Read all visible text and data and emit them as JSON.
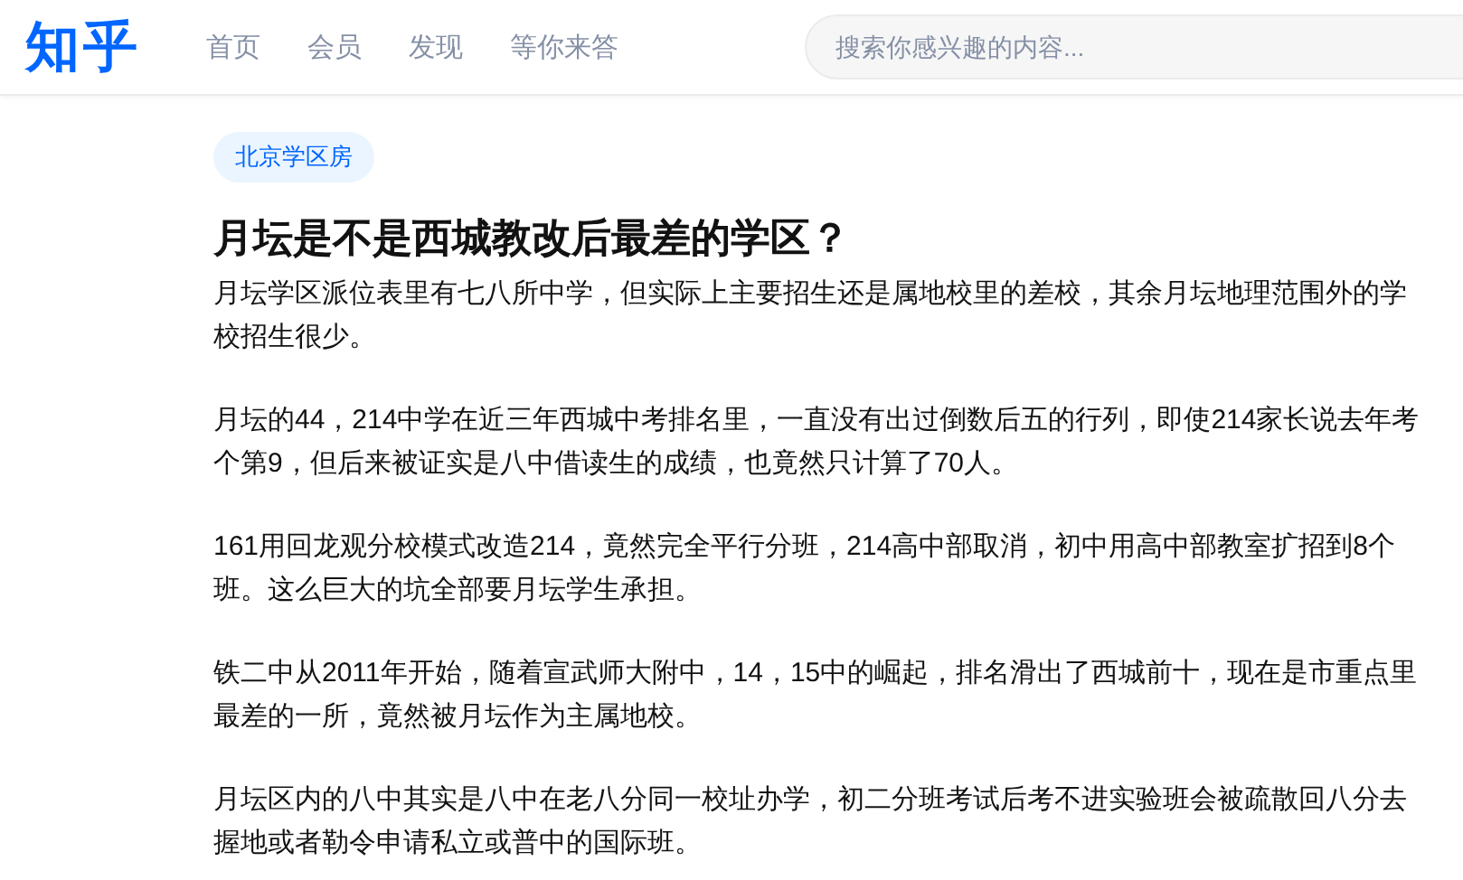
{
  "header": {
    "logo": "知乎",
    "nav": [
      {
        "label": "首页",
        "selected": false
      },
      {
        "label": "会员",
        "selected": false
      },
      {
        "label": "发现",
        "selected": false
      },
      {
        "label": "等你来答",
        "selected": false
      }
    ],
    "search": {
      "placeholder": "搜索你感兴趣的内容..."
    }
  },
  "topic_tag": "北京学区房",
  "question_title": "月坛是不是西城教改后最差的学区？",
  "paragraphs": [
    "月坛学区派位表里有七八所中学，但实际上主要招生还是属地校里的差校，其余月坛地理范围外的学校招生很少。",
    "月坛的44，214中学在近三年西城中考排名里，一直没有出过倒数后五的行列，即使214家长说去年考个第9，但后来被证实是八中借读生的成绩，也竟然只计算了70人。",
    "161用回龙观分校模式改造214，竟然完全平行分班，214高中部取消，初中用高中部教室扩招到8个班。这么巨大的坑全部要月坛学生承担。",
    "铁二中从2011年开始，随着宣武师大附中，14，15中的崛起，排名滑出了西城前十，现在是市重点里最差的一所，竟然被月坛作为主属地校。",
    "月坛区内的八中其实是八中在老八分同一校址办学，初二分班考试后考不进实验班会被疏散回八分去握地或者勒令申请私立或普中的国际班。"
  ]
}
